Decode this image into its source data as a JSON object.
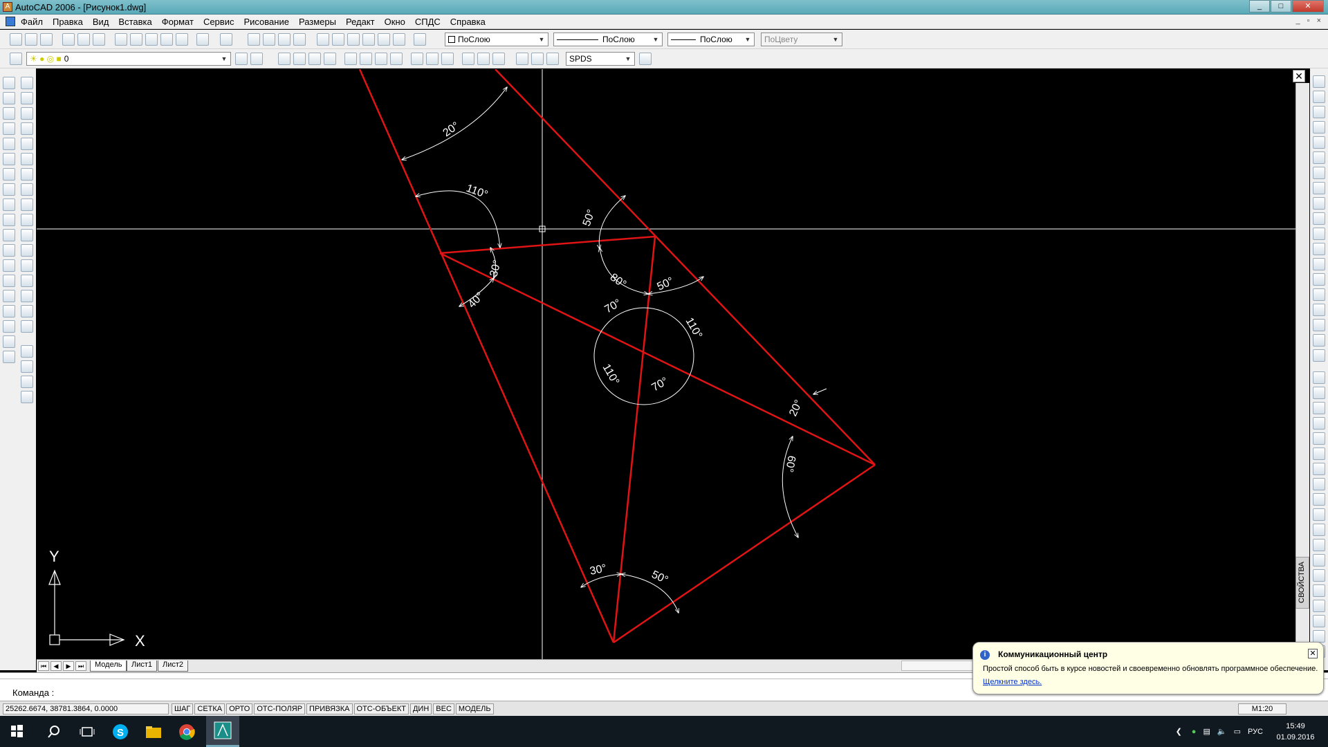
{
  "window": {
    "title": "AutoCAD 2006 - [Рисунок1.dwg]",
    "buttons": {
      "minimize": "_",
      "maximize": "□",
      "close": "✕"
    }
  },
  "menu": {
    "items": [
      "Файл",
      "Правка",
      "Вид",
      "Вставка",
      "Формат",
      "Сервис",
      "Рисование",
      "Размеры",
      "Редакт",
      "Окно",
      "СПДС",
      "Справка"
    ],
    "mdi": {
      "minimize": "_",
      "restore": "▫",
      "close": "×"
    }
  },
  "toolbar": {
    "color_combo": "ПоСлою",
    "linetype_combo": "ПоСлою",
    "lineweight_combo": "ПоСлою",
    "plotstyle_combo": "ПоЦвету",
    "layer_combo": "0",
    "textstyle_combo": "SPDS"
  },
  "drawing": {
    "line_color": "#e01414",
    "dim_color": "#ffffff",
    "crosshair_color": "#ffffff",
    "angle_labels": [
      "20°",
      "110°",
      "50°",
      "30°",
      "40°",
      "80°",
      "50°",
      "70°",
      "110°",
      "110°",
      "70°",
      "20°",
      "60°",
      "30°",
      "50°"
    ],
    "ucs": {
      "x_label": "X",
      "y_label": "Y"
    }
  },
  "props_tab": {
    "label": "СВОЙСТВА"
  },
  "layout_tabs": [
    "Модель",
    "Лист1",
    "Лист2"
  ],
  "command": {
    "prompt": "Команда :"
  },
  "status": {
    "coords": "25262.6674, 38781.3864, 0.0000",
    "modes": [
      "ШАГ",
      "СЕТКА",
      "ОРТО",
      "ОТС-ПОЛЯР",
      "ПРИВЯЗКА",
      "ОТС-ОБЪЕКТ",
      "ДИН",
      "ВЕС",
      "МОДЕЛЬ"
    ],
    "scale": "M1:20"
  },
  "notification": {
    "title": "Коммуникационный центр",
    "text": "Простой способ быть в курсе новостей и своевременно обновлять программное обеспечение.",
    "link": "Щелкните здесь."
  },
  "taskbar": {
    "lang": "РУС",
    "time": "15:49",
    "date": "01.09.2016"
  }
}
